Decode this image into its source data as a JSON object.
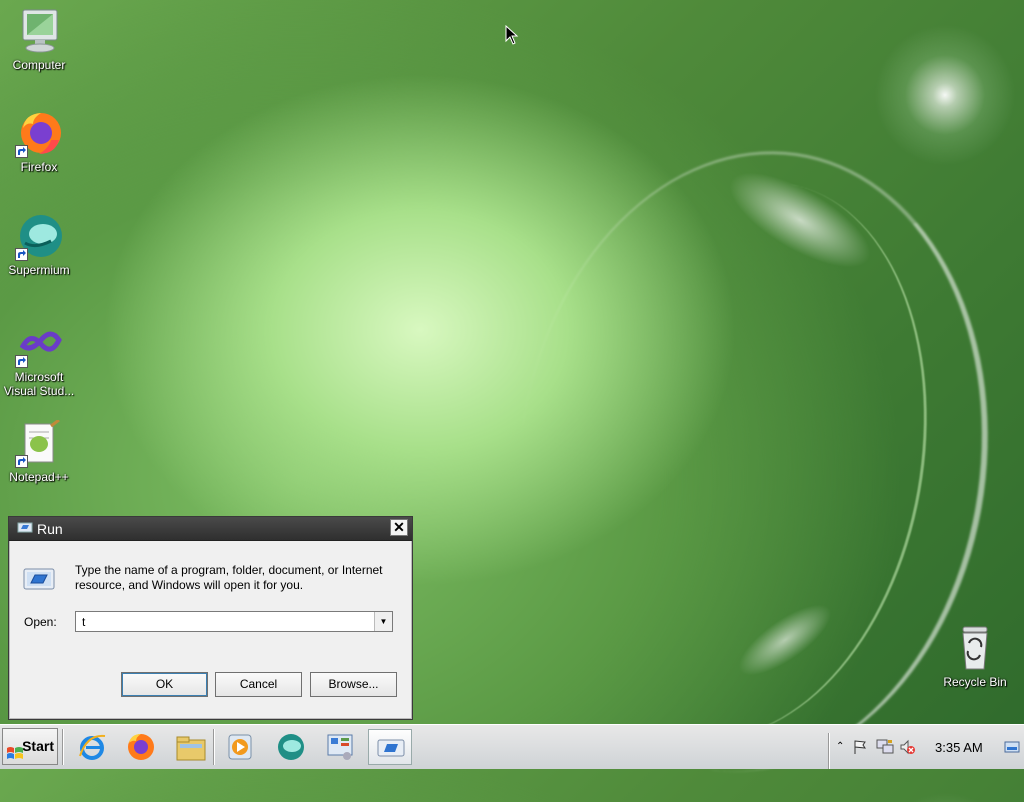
{
  "desktop": {
    "icons": [
      {
        "label": "Computer"
      },
      {
        "label": "Firefox"
      },
      {
        "label": "Supermium"
      },
      {
        "label": "Microsoft Visual Stud..."
      },
      {
        "label": "Notepad++"
      },
      {
        "label": "Recycle Bin"
      }
    ]
  },
  "run_dialog": {
    "title": "Run",
    "close_label": "✕",
    "description": "Type the name of a program, folder, document, or Internet resource, and Windows will open it for you.",
    "open_label": "Open:",
    "open_value": "t",
    "ok_label": "OK",
    "cancel_label": "Cancel",
    "browse_label": "Browse..."
  },
  "taskbar": {
    "start_label": "Start",
    "pinned": [
      "internet-explorer-icon",
      "firefox-icon",
      "file-explorer-icon",
      "media-player-icon",
      "supermium-icon",
      "control-panel-icon",
      "run-icon"
    ],
    "clock": "3:35 AM"
  }
}
